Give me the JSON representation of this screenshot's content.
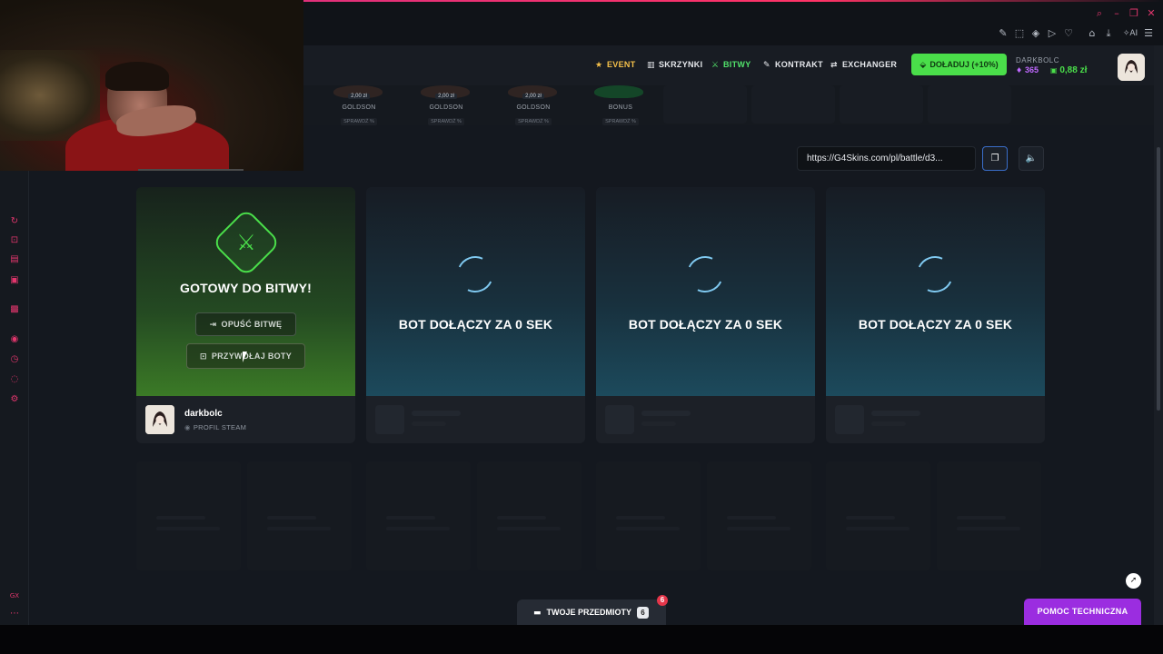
{
  "nav": {
    "event": "EVENT",
    "skrzynki": "SKRZYNKI",
    "bitwy": "BITWY",
    "kontrakt": "KONTRAKT",
    "exchanger": "EXCHANGER",
    "topup": "DOŁADUJ (+10%)",
    "username": "DARKBOLC",
    "points": "365",
    "balance": "0,88 zł",
    "colors": {
      "accent_green": "#4ade4a",
      "accent_purple": "#9b2de0",
      "accent_pink": "#e2366d"
    }
  },
  "cases": [
    {
      "price": "2,00 zł",
      "name": "GOLDSON",
      "check": "SPRAWDŹ %"
    },
    {
      "price": "2,00 zł",
      "name": "GOLDSON",
      "check": "SPRAWDŹ %"
    },
    {
      "price": "2,00 zł",
      "name": "GOLDSON",
      "check": "SPRAWDŹ %"
    },
    {
      "price": "",
      "name": "BONUS",
      "check": "SPRAWDŹ %"
    }
  ],
  "share": {
    "link": "https://G4Skins.com/pl/battle/d3...",
    "copy_icon": "copy-icon",
    "sound_icon": "sound-icon"
  },
  "slot1": {
    "title": "GOTOWY DO BITWY!",
    "leave": "OPUŚĆ BITWĘ",
    "call_bots": "PRZYWOŁAJ BOTY",
    "player_name": "darkbolc",
    "player_sub": "PROFIL STEAM"
  },
  "bots": [
    {
      "text": "BOT DOŁĄCZY ZA 0 SEK"
    },
    {
      "text": "BOT DOŁĄCZY ZA 0 SEK"
    },
    {
      "text": "BOT DOŁĄCZY ZA 0 SEK"
    }
  ],
  "footer": {
    "items_label": "TWOJE PRZEDMIOTY",
    "items_count": "6",
    "items_badge": "6",
    "support": "POMOC TECHNICZNA"
  },
  "left_rail": {
    "bottom_label": "GX"
  }
}
